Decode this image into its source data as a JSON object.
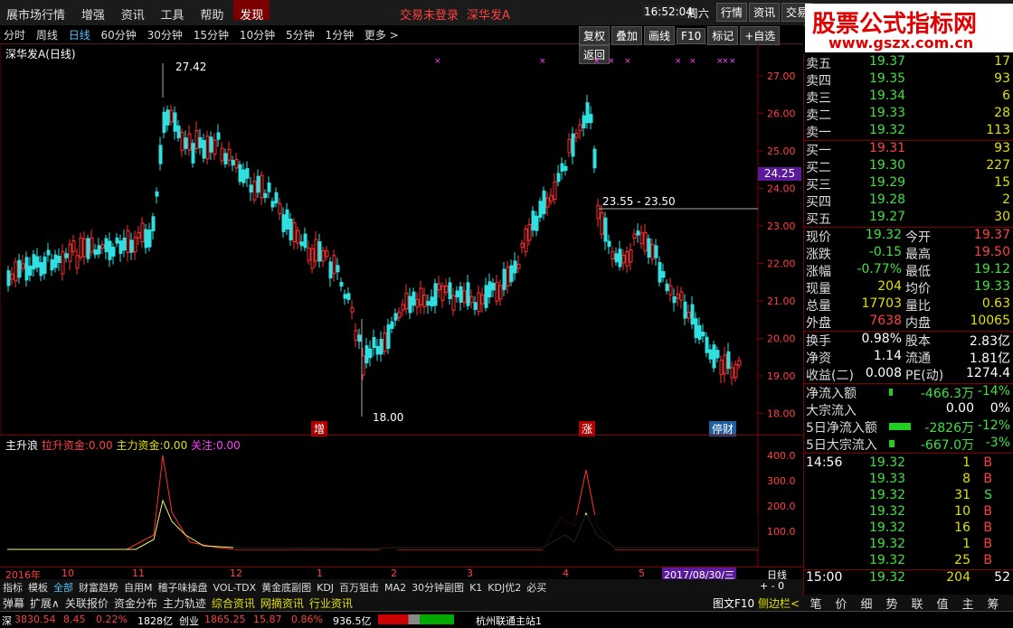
{
  "topmenu": [
    "展市场行情",
    "增强",
    "资讯",
    "工具",
    "帮助",
    "发现"
  ],
  "top_status": {
    "login": "交易未登录",
    "stock": "深华发A",
    "time": "16:52:04",
    "weekday": "周六"
  },
  "top_right_buttons": [
    "行情",
    "资讯",
    "交易"
  ],
  "logo": {
    "title": "股票公式指标网",
    "url": "www.gszx.com.cn"
  },
  "period_tabs": [
    "分时",
    "周线",
    "日线",
    "60分钟",
    "30分钟",
    "15分钟",
    "10分钟",
    "5分钟",
    "1分钟",
    "更多 >"
  ],
  "active_period": "日线",
  "chart_tools": [
    "复权",
    "叠加",
    "画线",
    "F10",
    "标记",
    "+自选",
    "返回"
  ],
  "chart_title": "深华发A(日线)",
  "price_labels": {
    "high": "27.42",
    "low": "18.00",
    "current": "24.25",
    "zone": "23.55 - 23.50"
  },
  "event_tags": [
    "增",
    "涨",
    "停财"
  ],
  "y_ticks": [
    "27.00",
    "26.00",
    "25.00",
    "24.00",
    "23.00",
    "22.00",
    "21.00",
    "20.00",
    "19.00",
    "18.00"
  ],
  "indicator": {
    "name": "主升浪",
    "lbl1": "拉升资金:",
    "v1": "0.00",
    "lbl2": "主力资金:",
    "v2": "0.00",
    "lbl3": "关注:",
    "v3": "0.00",
    "y_ticks": [
      "400.0",
      "300.0",
      "200.0",
      "100.0"
    ]
  },
  "date_axis": [
    "2016年",
    "10",
    "11",
    "12",
    "1",
    "2",
    "3",
    "4",
    "5"
  ],
  "date_cursor": "2017/08/30/三",
  "bottom_tabs": [
    "指标",
    "模板",
    "全部",
    "财富趋势",
    "自用M",
    "稽子味操盘",
    "VOL-TDX",
    "黄金底副图",
    "KDJ",
    "百万狙击",
    "MA2",
    "30分钟副图",
    "K1",
    "KDJ优2",
    "必买"
  ],
  "active_bottom_tab": "全部",
  "bottom_tabs2": [
    "弹幕",
    "扩展∧",
    "关联报价",
    "资金分布",
    "主力轨迹",
    "综合资讯",
    "网摘资讯",
    "行业资讯"
  ],
  "bottom_right": {
    "day": "日线",
    "figure": "图文F10",
    "side": "侧边栏<"
  },
  "order_book": {
    "sell": [
      {
        "label": "卖五",
        "price": "19.37",
        "vol": "17"
      },
      {
        "label": "卖四",
        "price": "19.35",
        "vol": "93"
      },
      {
        "label": "卖三",
        "price": "19.34",
        "vol": "6"
      },
      {
        "label": "卖二",
        "price": "19.33",
        "vol": "28"
      },
      {
        "label": "卖一",
        "price": "19.32",
        "vol": "113"
      }
    ],
    "buy": [
      {
        "label": "买一",
        "price": "19.31",
        "vol": "93"
      },
      {
        "label": "买二",
        "price": "19.30",
        "vol": "227"
      },
      {
        "label": "买三",
        "price": "19.29",
        "vol": "15"
      },
      {
        "label": "买四",
        "price": "19.28",
        "vol": "2"
      },
      {
        "label": "买五",
        "price": "19.27",
        "vol": "30"
      }
    ]
  },
  "quote": [
    {
      "l1": "现价",
      "v1": "19.32",
      "l2": "今开",
      "v2": "19.37"
    },
    {
      "l1": "涨跌",
      "v1": "-0.15",
      "l2": "最高",
      "v2": "19.50"
    },
    {
      "l1": "涨幅",
      "v1": "-0.77%",
      "l2": "最低",
      "v2": "19.12"
    },
    {
      "l1": "现量",
      "v1": "204",
      "l2": "均价",
      "v2": "19.33"
    },
    {
      "l1": "总量",
      "v1": "17703",
      "l2": "量比",
      "v2": "0.63"
    },
    {
      "l1": "外盘",
      "v1": "7638",
      "l2": "内盘",
      "v2": "10065"
    }
  ],
  "fundamentals": [
    {
      "l1": "换手",
      "v1": "0.98%",
      "l2": "股本",
      "v2": "2.83亿"
    },
    {
      "l1": "净资",
      "v1": "1.14",
      "l2": "流通",
      "v2": "1.81亿"
    },
    {
      "l1": "收益(二)",
      "v1": "0.008",
      "l2": "PE(动)",
      "v2": "1274.4"
    }
  ],
  "flows": [
    {
      "label": "净流入额",
      "value": "-466.3万",
      "pct": "-14%"
    },
    {
      "label": "大宗流入",
      "value": "0.00",
      "pct": "0%"
    },
    {
      "label": "5日净流入额",
      "value": "-2826万",
      "pct": "-12%"
    },
    {
      "label": "5日大宗流入",
      "value": "-667.0万",
      "pct": "-3%"
    }
  ],
  "ticks_time": "14:56",
  "ticks": [
    {
      "price": "19.32",
      "vol": "1",
      "side": "B"
    },
    {
      "price": "19.33",
      "vol": "8",
      "side": "B"
    },
    {
      "price": "19.32",
      "vol": "31",
      "side": "S"
    },
    {
      "price": "19.32",
      "vol": "10",
      "side": "B"
    },
    {
      "price": "19.32",
      "vol": "16",
      "side": "B"
    },
    {
      "price": "19.32",
      "vol": "1",
      "side": "B"
    },
    {
      "price": "19.32",
      "vol": "25",
      "side": "B"
    }
  ],
  "ticks_last": {
    "time": "15:00",
    "price": "19.32",
    "vol": "204",
    "num": "52"
  },
  "right_nav": [
    "笔",
    "价",
    "细",
    "势",
    "联",
    "值",
    "主",
    "筹"
  ],
  "statusbar": {
    "idx": "深",
    "idx_val": "3830.54",
    "idx_chg": "8.45",
    "idx_pct": "0.22%",
    "idx_amt": "1828亿",
    "cy": "创业",
    "cy_val": "1865.25",
    "cy_chg": "15.87",
    "cy_pct": "0.86%",
    "cy_amt": "936.5亿",
    "server": "杭州联通主站1"
  }
}
